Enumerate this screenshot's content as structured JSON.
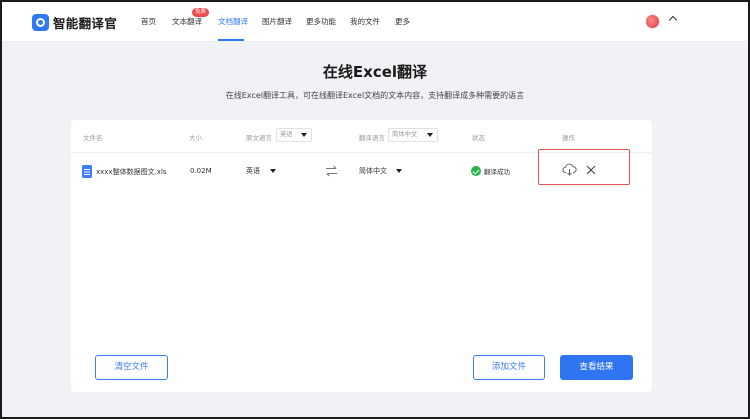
{
  "app": {
    "name": "智能翻译官"
  },
  "nav": {
    "items": [
      {
        "label": "首页"
      },
      {
        "label": "文本翻译",
        "badge": "免费"
      },
      {
        "label": "文档翻译",
        "active": true
      },
      {
        "label": "图片翻译"
      },
      {
        "label": "更多功能"
      },
      {
        "label": "我的文件"
      },
      {
        "label": "更多"
      }
    ]
  },
  "page": {
    "title": "在线Excel翻译",
    "subtitle": "在线Excel翻译工具，可在线翻译Excel文档的文本内容，支持翻译成多种需要的语言"
  },
  "table": {
    "headers": {
      "file_name": "文件名",
      "size": "大小",
      "source_lang": "原文语言",
      "target_lang": "翻译语言",
      "status": "状态",
      "actions": "操作"
    },
    "header_source_select": "英语",
    "header_target_select": "简体中文",
    "rows": [
      {
        "file_name": "xxxx整体数据图文.xls",
        "size": "0.02M",
        "source_lang": "英语",
        "target_lang": "简体中文",
        "status": "翻译成功"
      }
    ]
  },
  "buttons": {
    "clear": "清空文件",
    "add": "添加文件",
    "view": "查看结果"
  },
  "colors": {
    "accent": "#2f75f2",
    "success": "#28b446",
    "highlight": "#e25555",
    "badge": "#f04b4b"
  }
}
